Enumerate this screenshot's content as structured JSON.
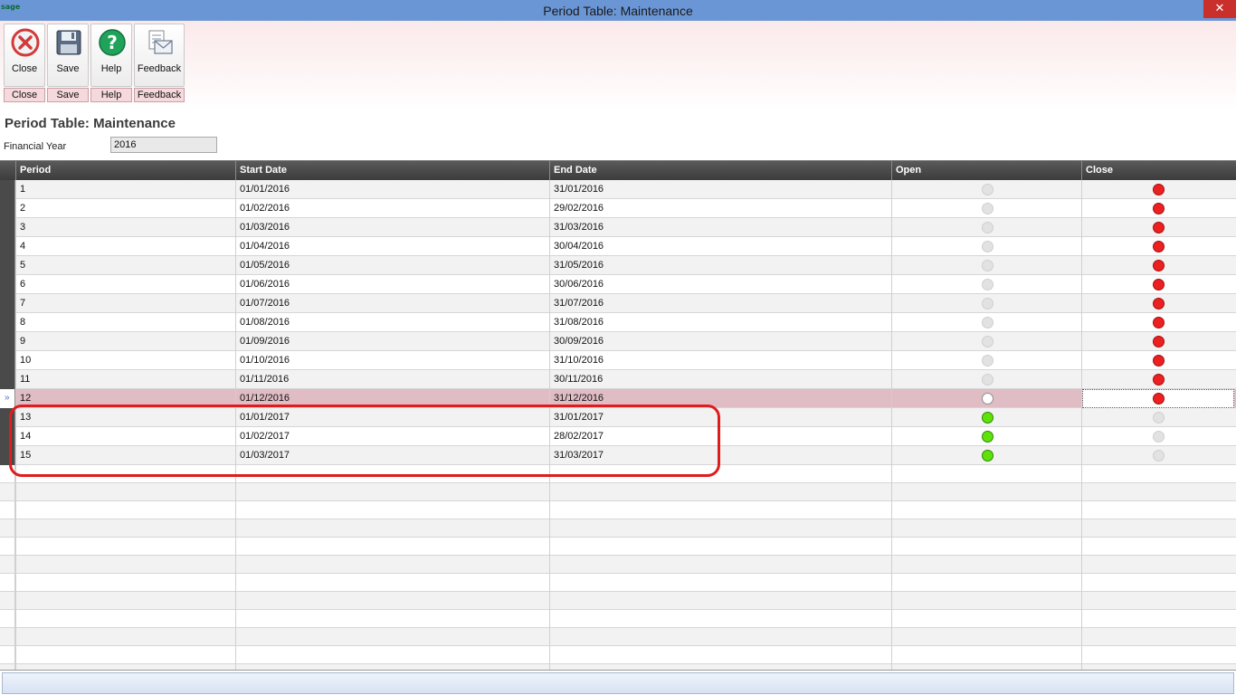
{
  "window": {
    "logo_text": "sage",
    "title": "Period Table: Maintenance",
    "close_glyph": "✕"
  },
  "toolbar": {
    "buttons": [
      {
        "label": "Close",
        "caption": "Close",
        "icon": "close-circle-icon"
      },
      {
        "label": "Save",
        "caption": "Save",
        "icon": "floppy-disk-icon"
      },
      {
        "label": "Help",
        "caption": "Help",
        "icon": "help-question-icon"
      },
      {
        "label": "Feedback",
        "caption": "Feedback",
        "icon": "feedback-envelope-icon"
      }
    ]
  },
  "page": {
    "title": "Period Table: Maintenance"
  },
  "form": {
    "financial_year_label": "Financial Year",
    "financial_year_value": "2016"
  },
  "grid": {
    "columns": [
      "Period",
      "Start Date",
      "End Date",
      "Open",
      "Close"
    ],
    "rows": [
      {
        "period": "1",
        "start": "01/01/2016",
        "end": "31/01/2016",
        "open": "grey",
        "close": "red"
      },
      {
        "period": "2",
        "start": "01/02/2016",
        "end": "29/02/2016",
        "open": "grey",
        "close": "red"
      },
      {
        "period": "3",
        "start": "01/03/2016",
        "end": "31/03/2016",
        "open": "grey",
        "close": "red"
      },
      {
        "period": "4",
        "start": "01/04/2016",
        "end": "30/04/2016",
        "open": "grey",
        "close": "red"
      },
      {
        "period": "5",
        "start": "01/05/2016",
        "end": "31/05/2016",
        "open": "grey",
        "close": "red"
      },
      {
        "period": "6",
        "start": "01/06/2016",
        "end": "30/06/2016",
        "open": "grey",
        "close": "red"
      },
      {
        "period": "7",
        "start": "01/07/2016",
        "end": "31/07/2016",
        "open": "grey",
        "close": "red"
      },
      {
        "period": "8",
        "start": "01/08/2016",
        "end": "31/08/2016",
        "open": "grey",
        "close": "red"
      },
      {
        "period": "9",
        "start": "01/09/2016",
        "end": "30/09/2016",
        "open": "grey",
        "close": "red"
      },
      {
        "period": "10",
        "start": "01/10/2016",
        "end": "31/10/2016",
        "open": "grey",
        "close": "red"
      },
      {
        "period": "11",
        "start": "01/11/2016",
        "end": "30/11/2016",
        "open": "grey",
        "close": "red"
      },
      {
        "period": "12",
        "start": "01/12/2016",
        "end": "31/12/2016",
        "open": "white",
        "close": "red",
        "selected": true
      },
      {
        "period": "13",
        "start": "01/01/2017",
        "end": "31/01/2017",
        "open": "green",
        "close": "grey"
      },
      {
        "period": "14",
        "start": "01/02/2017",
        "end": "28/02/2017",
        "open": "green",
        "close": "grey"
      },
      {
        "period": "15",
        "start": "01/03/2017",
        "end": "31/03/2017",
        "open": "green",
        "close": "grey"
      }
    ]
  },
  "colors": {
    "titlebar": "#6b96d6",
    "header": "#3c3c3c",
    "selected_row": "#e0bcc5",
    "annotation": "#e01c1c",
    "dot_red": "#ec2020",
    "dot_green": "#5fe20a",
    "dot_grey": "#e2e2e2"
  }
}
